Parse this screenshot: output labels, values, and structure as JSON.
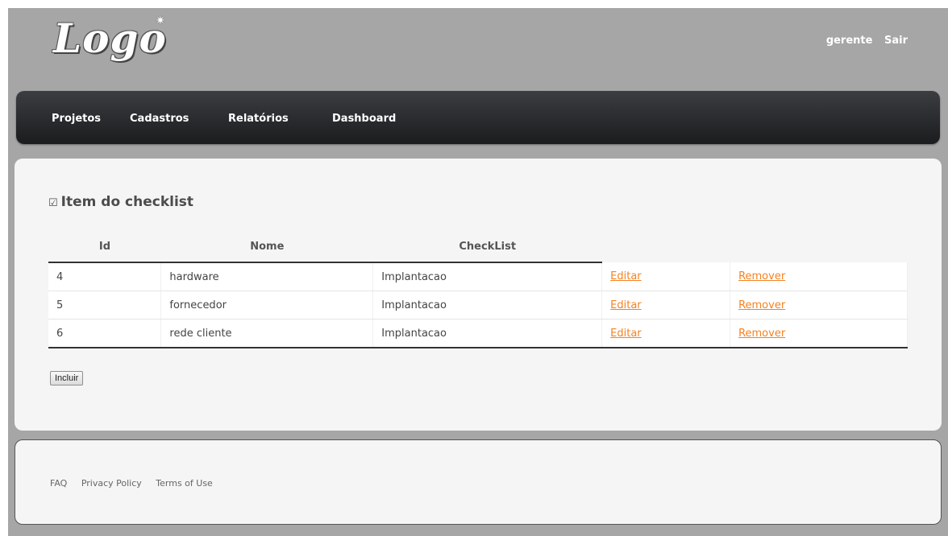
{
  "header": {
    "logo_text": "Logo",
    "user": "gerente",
    "logout": "Sair"
  },
  "nav": {
    "items": [
      "Projetos",
      "Cadastros",
      "Relatórios",
      "Dashboard"
    ]
  },
  "main": {
    "title": "Item do checklist",
    "table": {
      "columns": [
        "Id",
        "Nome",
        "CheckList"
      ],
      "rows": [
        {
          "id": "4",
          "nome": "hardware",
          "checklist": "Implantacao",
          "edit": "Editar",
          "remove": "Remover"
        },
        {
          "id": "5",
          "nome": "fornecedor",
          "checklist": "Implantacao",
          "edit": "Editar",
          "remove": "Remover"
        },
        {
          "id": "6",
          "nome": "rede cliente",
          "checklist": "Implantacao",
          "edit": "Editar",
          "remove": "Remover"
        }
      ]
    },
    "add_button": "Incluir"
  },
  "footer": {
    "links": [
      "FAQ",
      "Privacy Policy",
      "Terms of Use"
    ]
  }
}
